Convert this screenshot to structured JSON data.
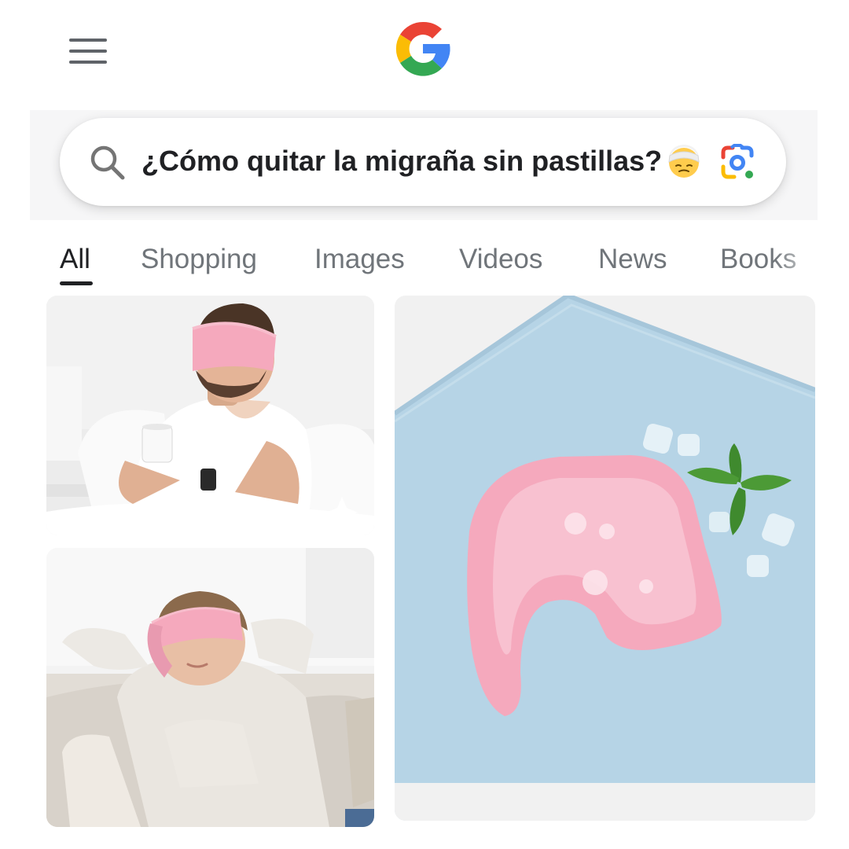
{
  "header": {
    "menu_icon": "hamburger-menu-icon",
    "logo": "google-g-logo"
  },
  "search": {
    "query": "¿Cómo quitar la migraña sin pastillas?",
    "emoji": "face-with-head-bandage-emoji",
    "search_icon": "magnifier-icon",
    "lens_icon": "google-lens-icon"
  },
  "tabs": [
    {
      "label": "All",
      "active": true
    },
    {
      "label": "Shopping",
      "active": false
    },
    {
      "label": "Images",
      "active": false
    },
    {
      "label": "Videos",
      "active": false
    },
    {
      "label": "News",
      "active": false
    },
    {
      "label": "Books",
      "active": false
    }
  ],
  "results": [
    {
      "description": "man in bed wearing pink eye mask holding a cup"
    },
    {
      "description": "pink gel eye mask on light blue towel with ice cubes and mint"
    },
    {
      "description": "woman relaxing on sofa wearing pink eye mask"
    }
  ],
  "colors": {
    "google_blue": "#4285F4",
    "google_red": "#EA4335",
    "google_yellow": "#FBBC05",
    "google_green": "#34A853",
    "mask_pink": "#F5A9BD",
    "towel_blue": "#B6D4E6"
  }
}
